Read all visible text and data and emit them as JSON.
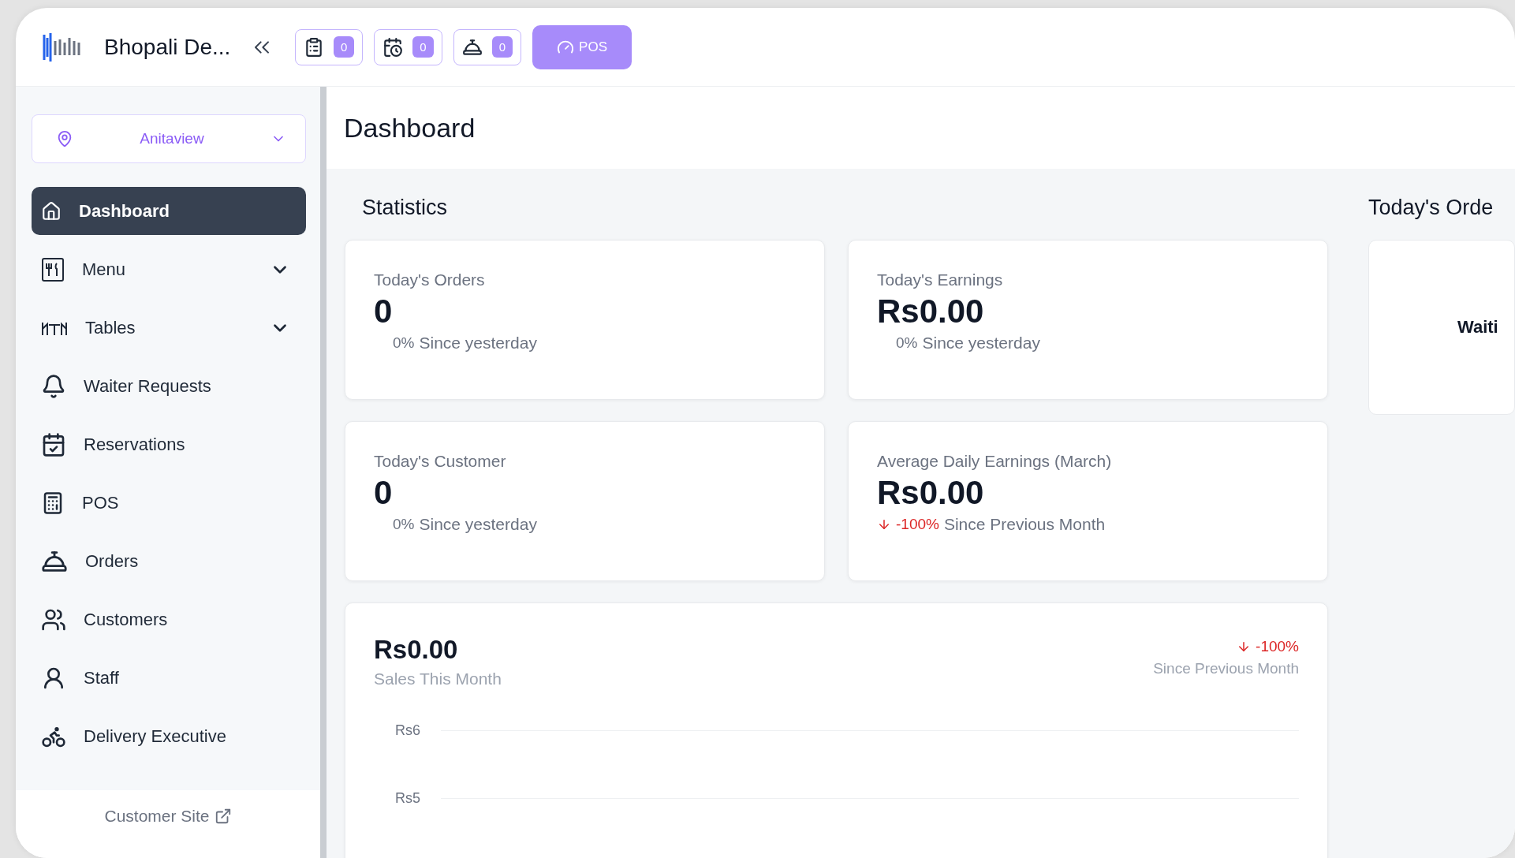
{
  "header": {
    "brand": "Bhopali De...",
    "quick_actions": [
      {
        "kind": "waiter",
        "count": "0"
      },
      {
        "kind": "reservation",
        "count": "0"
      },
      {
        "kind": "order",
        "count": "0"
      }
    ],
    "pos_button": "POS"
  },
  "sidebar": {
    "location": "Anitaview",
    "items": [
      {
        "kind": "link",
        "label": "Dashboard",
        "selected": true
      },
      {
        "kind": "group",
        "label": "Menu",
        "selected": false,
        "expanded": false
      },
      {
        "kind": "group",
        "label": "Tables",
        "selected": false,
        "expanded": false
      },
      {
        "kind": "link",
        "label": "Waiter Requests",
        "selected": false
      },
      {
        "kind": "link",
        "label": "Reservations",
        "selected": false
      },
      {
        "kind": "link",
        "label": "POS",
        "selected": false
      },
      {
        "kind": "link",
        "label": "Orders",
        "selected": false
      },
      {
        "kind": "link",
        "label": "Customers",
        "selected": false
      },
      {
        "kind": "link",
        "label": "Staff",
        "selected": false
      },
      {
        "kind": "link",
        "label": "Delivery Executive",
        "selected": false
      }
    ],
    "footer_link": "Customer Site"
  },
  "main": {
    "title": "Dashboard",
    "statistics": {
      "title": "Statistics",
      "cards": [
        {
          "label": "Today's Orders",
          "value": "0",
          "change": "0%",
          "declining": false,
          "note": "Since yesterday"
        },
        {
          "label": "Today's Earnings",
          "value": "Rs0.00",
          "change": "0%",
          "declining": false,
          "note": "Since yesterday"
        },
        {
          "label": "Today's Customer",
          "value": "0",
          "change": "0%",
          "declining": false,
          "note": "Since yesterday"
        },
        {
          "label": "Average Daily Earnings (March)",
          "value": "Rs0.00",
          "change": "-100%",
          "declining": true,
          "note": "Since Previous Month"
        }
      ]
    },
    "sales": {
      "value": "Rs0.00",
      "label": "Sales This Month",
      "change": "-100%",
      "declining": true,
      "note": "Since Previous Month",
      "y_tick_labels": [
        "Rs6",
        "Rs5"
      ]
    },
    "today_orders": {
      "title": "Today's Orde",
      "status": "Waiti"
    }
  }
}
